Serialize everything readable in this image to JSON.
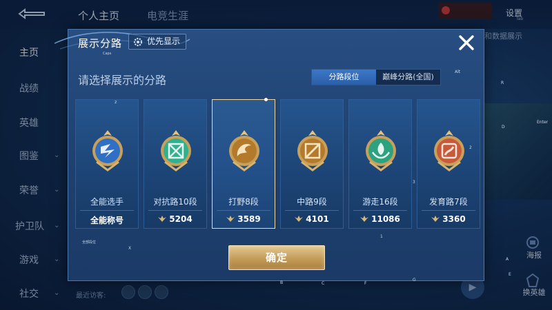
{
  "header": {
    "tabs": [
      "个人主页",
      "电竞生涯"
    ],
    "settings": "设置",
    "tab_hint": "Tab",
    "data_show": "和数据展示"
  },
  "left_nav": {
    "items": [
      {
        "label": "主页",
        "active": true
      },
      {
        "label": "战绩"
      },
      {
        "label": "英雄"
      },
      {
        "label": "图鉴",
        "chevron": true
      },
      {
        "label": "荣誉",
        "chevron": true
      },
      {
        "label": "护卫队",
        "chevron": true
      },
      {
        "label": "游戏",
        "chevron": true
      },
      {
        "label": "社交",
        "chevron": true
      }
    ]
  },
  "visitors": {
    "label": "最近访客:"
  },
  "right_bar": {
    "poster": "海报",
    "switch_hero": "换英雄"
  },
  "dialog": {
    "title": "展示分路",
    "priority_label": "优先显示",
    "caps_hint": "Caps",
    "subtitle": "请选择展示的分路",
    "toggle": [
      "分路段位",
      "巅峰分路(全国)"
    ],
    "toggle_active": 0,
    "confirm": "确定",
    "corner_hint": "全部段位",
    "cards": [
      {
        "name": "全能选手",
        "value": "全能称号",
        "emblem_color": "#2f6fc4",
        "hint": "2"
      },
      {
        "name": "对抗路10段",
        "value": "5204",
        "emblem_color": "#2fb08e"
      },
      {
        "name": "打野8段",
        "value": "3589",
        "emblem_color": "#d99a3a",
        "selected": true
      },
      {
        "name": "中路9段",
        "value": "4101",
        "emblem_color": "#e0a64a"
      },
      {
        "name": "游走16段",
        "value": "11086",
        "emblem_color": "#2da27f"
      },
      {
        "name": "发育路7段",
        "value": "3360",
        "emblem_color": "#d66a4a"
      }
    ]
  },
  "key_hints": [
    "X",
    "B",
    "C",
    "F",
    "G",
    "1",
    "2",
    "A",
    "R",
    "D",
    "E",
    "Enter",
    "3",
    "Alt"
  ],
  "colors": {
    "dialog_bg": "#1f4272",
    "card_bg": "#1d4577",
    "accent_gold": "#c49b57",
    "toggle_active": "#2b5fa8"
  }
}
